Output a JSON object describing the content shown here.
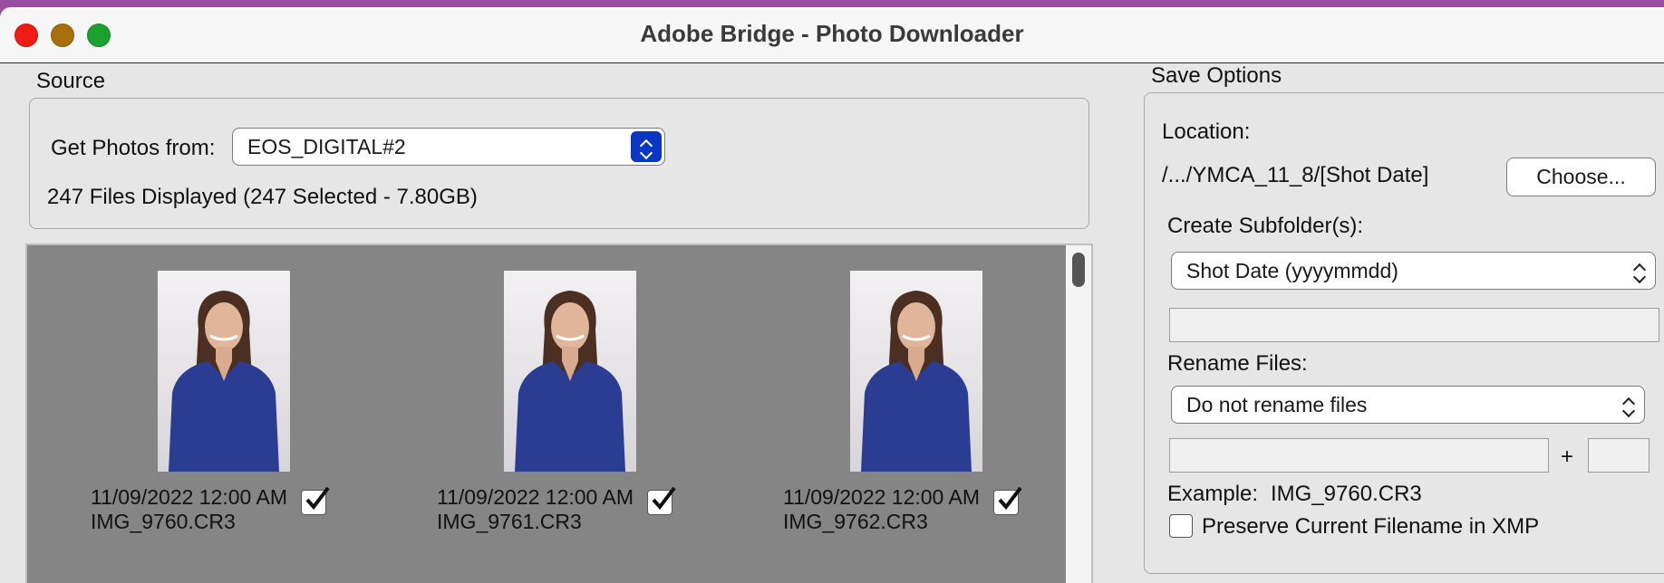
{
  "window": {
    "title": "Adobe Bridge - Photo Downloader"
  },
  "source": {
    "section_label": "Source",
    "get_photos_label": "Get Photos from:",
    "device_value": "EOS_DIGITAL#2",
    "files_summary": "247 Files Displayed (247 Selected - 7.80GB)"
  },
  "gallery": {
    "items": [
      {
        "date": "11/09/2022 12:00 AM",
        "filename": "IMG_9760.CR3",
        "checked": true
      },
      {
        "date": "11/09/2022 12:00 AM",
        "filename": "IMG_9761.CR3",
        "checked": true
      },
      {
        "date": "11/09/2022 12:00 AM",
        "filename": "IMG_9762.CR3",
        "checked": true
      }
    ]
  },
  "save_options": {
    "section_label": "Save Options",
    "location_label": "Location:",
    "location_path": "/.../YMCA_11_8/[Shot Date]",
    "choose_button": "Choose...",
    "subfolder_label": "Create Subfolder(s):",
    "subfolder_value": "Shot Date (yyyymmdd)",
    "subfolder_custom": "",
    "rename_label": "Rename Files:",
    "rename_value": "Do not rename files",
    "rename_text": "",
    "plus": "+",
    "rename_number": "",
    "example_label": "Example:",
    "example_value": "IMG_9760.CR3",
    "preserve_label": "Preserve Current Filename in XMP",
    "preserve_checked": false
  },
  "colors": {
    "close": "#ee1c14",
    "minimize": "#a86f0c",
    "maximize": "#1ba12d",
    "accent": "#0a36c4",
    "gallery_bg": "#858585"
  }
}
